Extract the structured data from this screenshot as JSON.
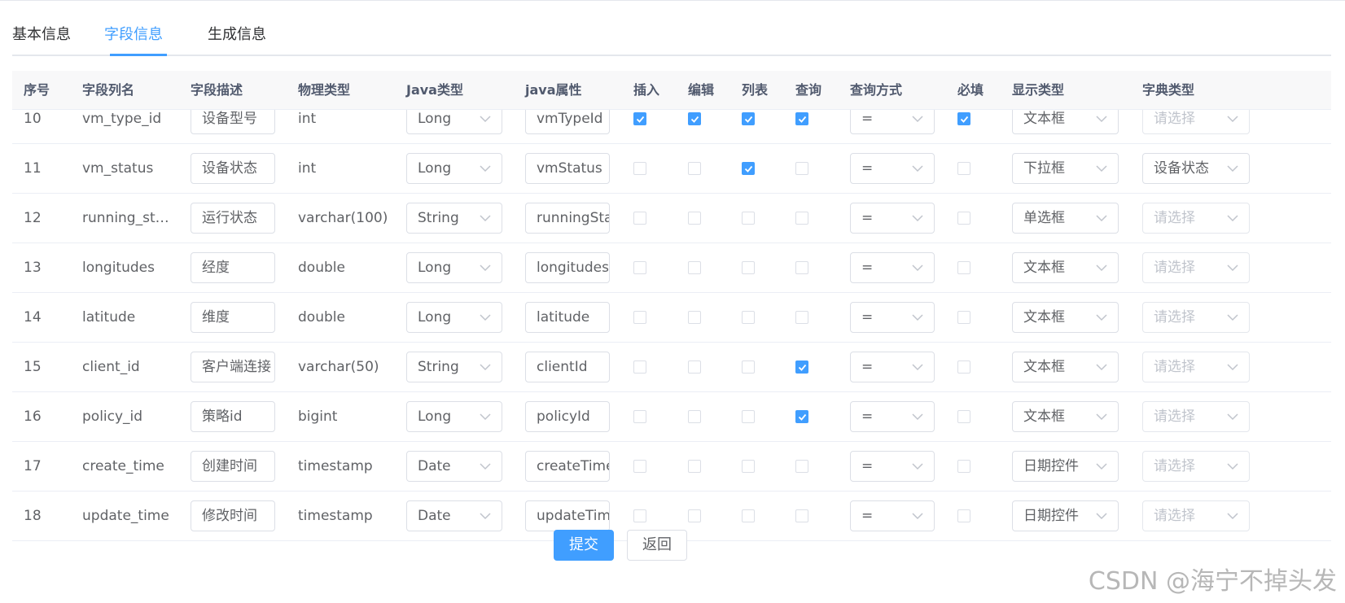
{
  "tabs": [
    "基本信息",
    "字段信息",
    "生成信息"
  ],
  "active_tab": 1,
  "columns": [
    "序号",
    "字段列名",
    "字段描述",
    "物理类型",
    "Java类型",
    "java属性",
    "插入",
    "编辑",
    "列表",
    "查询",
    "查询方式",
    "必填",
    "显示类型",
    "字典类型"
  ],
  "rows": [
    {
      "no": "10",
      "column": "vm_type_id",
      "desc": "设备型号",
      "phys": "int",
      "java_type": "Long",
      "java_field": "vmTypeId",
      "insert": true,
      "edit": true,
      "list": true,
      "query": true,
      "query_type": "=",
      "required": true,
      "html_type": "文本框",
      "dict": "请选择",
      "dict_placeholder": true
    },
    {
      "no": "11",
      "column": "vm_status",
      "desc": "设备状态",
      "phys": "int",
      "java_type": "Long",
      "java_field": "vmStatus",
      "insert": false,
      "edit": false,
      "list": true,
      "query": false,
      "query_type": "=",
      "required": false,
      "html_type": "下拉框",
      "dict": "设备状态",
      "dict_placeholder": false
    },
    {
      "no": "12",
      "column": "running_st…",
      "desc": "运行状态",
      "phys": "varchar(100)",
      "java_type": "String",
      "java_field": "runningSta",
      "insert": false,
      "edit": false,
      "list": false,
      "query": false,
      "query_type": "=",
      "required": false,
      "html_type": "单选框",
      "dict": "请选择",
      "dict_placeholder": true
    },
    {
      "no": "13",
      "column": "longitudes",
      "desc": "经度",
      "phys": "double",
      "java_type": "Long",
      "java_field": "longitudes",
      "insert": false,
      "edit": false,
      "list": false,
      "query": false,
      "query_type": "=",
      "required": false,
      "html_type": "文本框",
      "dict": "请选择",
      "dict_placeholder": true
    },
    {
      "no": "14",
      "column": "latitude",
      "desc": "维度",
      "phys": "double",
      "java_type": "Long",
      "java_field": "latitude",
      "insert": false,
      "edit": false,
      "list": false,
      "query": false,
      "query_type": "=",
      "required": false,
      "html_type": "文本框",
      "dict": "请选择",
      "dict_placeholder": true
    },
    {
      "no": "15",
      "column": "client_id",
      "desc": "客户端连接",
      "phys": "varchar(50)",
      "java_type": "String",
      "java_field": "clientId",
      "insert": false,
      "edit": false,
      "list": false,
      "query": true,
      "query_type": "=",
      "required": false,
      "html_type": "文本框",
      "dict": "请选择",
      "dict_placeholder": true
    },
    {
      "no": "16",
      "column": "policy_id",
      "desc": "策略id",
      "phys": "bigint",
      "java_type": "Long",
      "java_field": "policyId",
      "insert": false,
      "edit": false,
      "list": false,
      "query": true,
      "query_type": "=",
      "required": false,
      "html_type": "文本框",
      "dict": "请选择",
      "dict_placeholder": true
    },
    {
      "no": "17",
      "column": "create_time",
      "desc": "创建时间",
      "phys": "timestamp",
      "java_type": "Date",
      "java_field": "createTime",
      "insert": false,
      "edit": false,
      "list": false,
      "query": false,
      "query_type": "=",
      "required": false,
      "html_type": "日期控件",
      "dict": "请选择",
      "dict_placeholder": true
    },
    {
      "no": "18",
      "column": "update_time",
      "desc": "修改时间",
      "phys": "timestamp",
      "java_type": "Date",
      "java_field": "updateTime",
      "insert": false,
      "edit": false,
      "list": false,
      "query": false,
      "query_type": "=",
      "required": false,
      "html_type": "日期控件",
      "dict": "请选择",
      "dict_placeholder": true
    }
  ],
  "actions": {
    "submit": "提交",
    "back": "返回"
  },
  "watermark": "CSDN @海宁不掉头发",
  "colors": {
    "accent": "#409eff",
    "border": "#dcdfe6",
    "header_bg": "#f8f8f9"
  }
}
